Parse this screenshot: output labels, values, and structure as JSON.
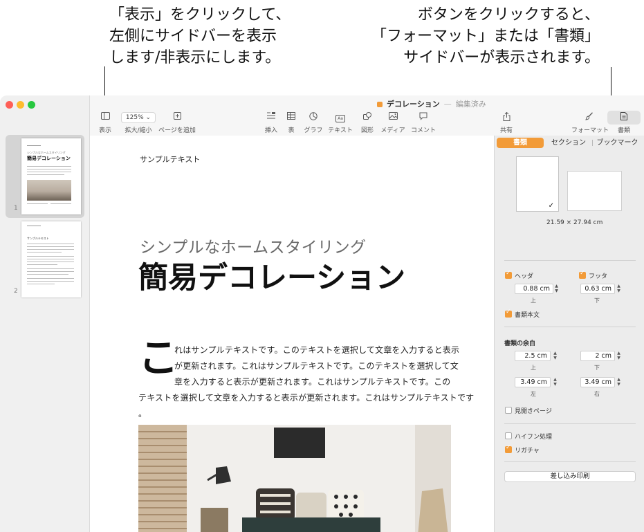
{
  "callouts": {
    "left": [
      "「表示」をクリックして、",
      "左側にサイドバーを表示",
      "します/非表示にします。"
    ],
    "right": [
      "ボタンをクリックすると、",
      "「フォーマット」または「書類」",
      "サイドバーが表示されます。"
    ]
  },
  "window": {
    "doc_name": "デコレーション",
    "doc_state": "編集済み",
    "accent_color": "#f29b38"
  },
  "toolbar": {
    "view_label": "表示",
    "zoom_value": "125%",
    "zoom_label": "拡大/縮小",
    "add_page_label": "ページを追加",
    "insert_label": "挿入",
    "table_label": "表",
    "chart_label": "グラフ",
    "text_label": "テキスト",
    "shape_label": "図形",
    "media_label": "メディア",
    "comment_label": "コメント",
    "share_label": "共有",
    "format_label": "フォーマット",
    "document_label": "書類",
    "text_icon_glyph": "Aa"
  },
  "thumbnails": {
    "page1_number": "1",
    "page2_number": "2",
    "page1_subtitle": "シンプルなホームスタイリング",
    "page1_title": "簡易デコレーション",
    "page2_heading": "サンプルテキスト"
  },
  "document": {
    "header": "サンプルテキスト",
    "subtitle": "シンプルなホームスタイリング",
    "title": "簡易デコレーション",
    "dropcap": "こ",
    "body_lines": [
      "れはサンプルテキストです。このテキストを選択して文章を入力すると表示",
      "が更新されます。これはサンプルテキストです。このテキストを選択して文",
      "章を入力すると表示が更新されます。これはサンプルテキストです。この",
      "テキストを選択して文章を入力すると表示が更新されます。これはサンプルテキストです",
      "。"
    ]
  },
  "inspector": {
    "tabs": [
      "書類",
      "セクション",
      "ブックマーク"
    ],
    "active_tab": "書類",
    "paper_size": "21.59 × 27.94 cm",
    "header_label": "ヘッダ",
    "footer_label": "フッタ",
    "header_value": "0.88 cm",
    "footer_value": "0.63 cm",
    "top_label": "上",
    "bottom_label": "下",
    "body_label": "書類本文",
    "margins_heading": "書類の余白",
    "margin_top": "2.5 cm",
    "margin_bottom": "2 cm",
    "margin_left": "3.49 cm",
    "margin_right": "3.49 cm",
    "left_label": "左",
    "right_label": "右",
    "facing_pages_label": "見開きページ",
    "hyphenation_label": "ハイフン処理",
    "ligatures_label": "リガチャ",
    "mail_merge_label": "差し込み印刷",
    "header_checked": true,
    "footer_checked": true,
    "body_checked": true,
    "facing_checked": false,
    "hyphenation_checked": false,
    "ligatures_checked": true
  }
}
